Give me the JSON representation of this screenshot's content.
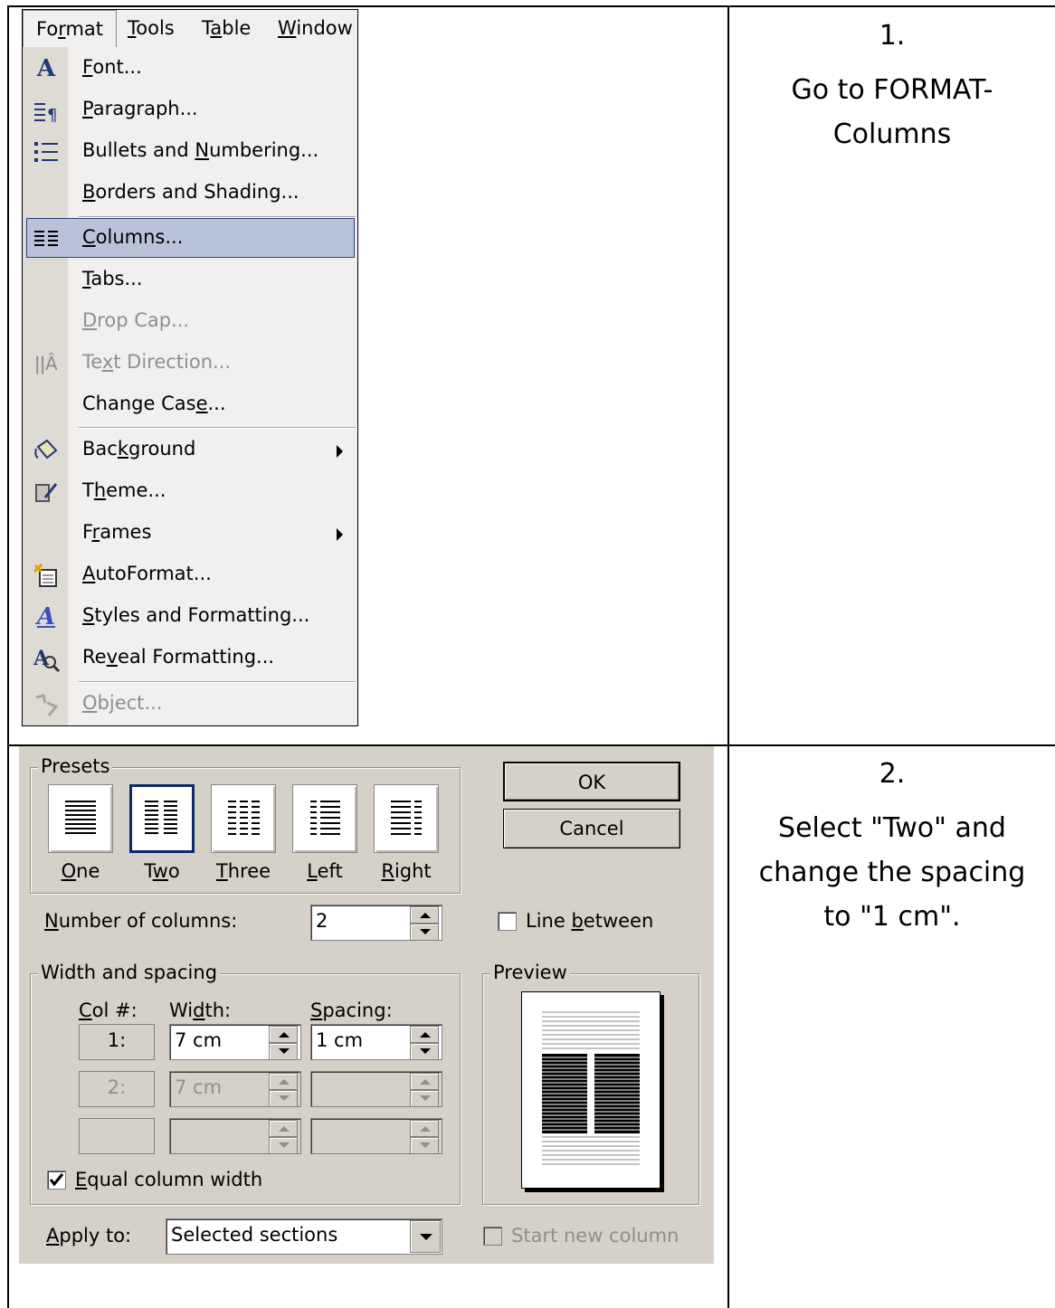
{
  "menu": {
    "bar": [
      "Format",
      "Tools",
      "Table",
      "Window"
    ],
    "items": [
      {
        "label": "Font...",
        "icon": "font-A-icon"
      },
      {
        "label": "Paragraph...",
        "icon": "paragraph-icon"
      },
      {
        "label": "Bullets and Numbering...",
        "icon": "bullets-icon"
      },
      {
        "label": "Borders and Shading..."
      },
      {
        "label": "Columns...",
        "icon": "columns-icon",
        "selected": true
      },
      {
        "label": "Tabs..."
      },
      {
        "label": "Drop Cap...",
        "disabled": true
      },
      {
        "label": "Text Direction...",
        "icon": "text-direction-icon",
        "disabled": true
      },
      {
        "label": "Change Case..."
      },
      {
        "label": "Background",
        "icon": "paint-bucket-icon",
        "submenu": true
      },
      {
        "label": "Theme...",
        "icon": "theme-icon"
      },
      {
        "label": "Frames",
        "submenu": true
      },
      {
        "label": "AutoFormat...",
        "icon": "autoformat-icon"
      },
      {
        "label": "Styles and Formatting...",
        "icon": "styles-icon"
      },
      {
        "label": "Reveal Formatting...",
        "icon": "reveal-formatting-icon"
      },
      {
        "label": "Object...",
        "icon": "object-icon",
        "disabled": true
      }
    ],
    "selection_color": "#b9c2d9"
  },
  "steps": [
    {
      "number": "1.",
      "text_lines": [
        "Go to FORMAT-",
        "Columns"
      ]
    },
    {
      "number": "2.",
      "text_lines": [
        "Select \"Two\" and",
        "change the spacing",
        "to \"1 cm\"."
      ]
    }
  ],
  "dialog": {
    "presets_label": "Presets",
    "presets": [
      "One",
      "Two",
      "Three",
      "Left",
      "Right"
    ],
    "selected_preset": "Two",
    "ok_label": "OK",
    "cancel_label": "Cancel",
    "num_columns_label": "Number of columns:",
    "num_columns_value": "2",
    "line_between_label": "Line between",
    "line_between_checked": false,
    "width_spacing_label": "Width and spacing",
    "col_header": "Col #:",
    "width_header": "Width:",
    "spacing_header": "Spacing:",
    "rows": [
      {
        "col": "1:",
        "width": "7 cm",
        "spacing": "1 cm"
      },
      {
        "col": "2:",
        "width": "7 cm",
        "spacing": ""
      },
      {
        "col": "",
        "width": "",
        "spacing": ""
      }
    ],
    "equal_width_label": "Equal column width",
    "equal_width_checked": true,
    "preview_label": "Preview",
    "apply_to_label": "Apply to:",
    "apply_to_value": "Selected sections",
    "start_new_column_label": "Start new column",
    "start_new_column_checked": false,
    "background_color": "#d5d1c9"
  }
}
